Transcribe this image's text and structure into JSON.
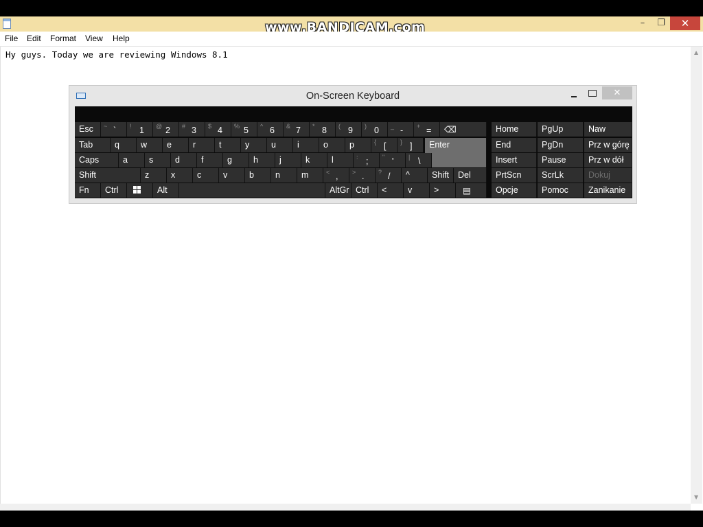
{
  "watermark": "www.BANDICAM.com",
  "window": {
    "minimize_glyph": "–",
    "maximize_glyph": "❐",
    "close_glyph": "✕",
    "icon": "notepad-icon"
  },
  "menu": {
    "items": [
      "File",
      "Edit",
      "Format",
      "View",
      "Help"
    ]
  },
  "editor": {
    "text": "Hy guys. Today we are reviewing Windows 8.1"
  },
  "osk": {
    "title": "On-Screen Keyboard",
    "close_glyph": "✕",
    "rows": {
      "row1": [
        {
          "main": "Esc"
        },
        {
          "shift": "~",
          "main": "`"
        },
        {
          "shift": "!",
          "main": "1"
        },
        {
          "shift": "@",
          "main": "2"
        },
        {
          "shift": "#",
          "main": "3"
        },
        {
          "shift": "$",
          "main": "4"
        },
        {
          "shift": "%",
          "main": "5"
        },
        {
          "shift": "^",
          "main": "6"
        },
        {
          "shift": "&",
          "main": "7"
        },
        {
          "shift": "*",
          "main": "8"
        },
        {
          "shift": "(",
          "main": "9"
        },
        {
          "shift": ")",
          "main": "0"
        },
        {
          "shift": "_",
          "main": "-"
        },
        {
          "shift": "+",
          "main": "="
        },
        {
          "main": "⌫"
        }
      ],
      "row2": [
        {
          "main": "Tab"
        },
        {
          "main": "q"
        },
        {
          "main": "w"
        },
        {
          "main": "e"
        },
        {
          "main": "r"
        },
        {
          "main": "t"
        },
        {
          "main": "y"
        },
        {
          "main": "u"
        },
        {
          "main": "i"
        },
        {
          "main": "o"
        },
        {
          "main": "p"
        },
        {
          "shift": "{",
          "main": "["
        },
        {
          "shift": "}",
          "main": "]"
        },
        {
          "main": "Enter"
        }
      ],
      "row3": [
        {
          "main": "Caps"
        },
        {
          "main": "a"
        },
        {
          "main": "s"
        },
        {
          "main": "d"
        },
        {
          "main": "f"
        },
        {
          "main": "g"
        },
        {
          "main": "h"
        },
        {
          "main": "j"
        },
        {
          "main": "k"
        },
        {
          "main": "l"
        },
        {
          "shift": ":",
          "main": ";"
        },
        {
          "shift": "\"",
          "main": "'"
        },
        {
          "shift": "|",
          "main": "\\"
        }
      ],
      "row4": [
        {
          "main": "Shift"
        },
        {
          "main": "z"
        },
        {
          "main": "x"
        },
        {
          "main": "c"
        },
        {
          "main": "v"
        },
        {
          "main": "b"
        },
        {
          "main": "n"
        },
        {
          "main": "m"
        },
        {
          "shift": "<",
          "main": ","
        },
        {
          "shift": ">",
          "main": "."
        },
        {
          "shift": "?",
          "main": "/"
        },
        {
          "main": "^"
        },
        {
          "main": "Shift"
        },
        {
          "main": "Del"
        }
      ],
      "row5": [
        {
          "main": "Fn"
        },
        {
          "main": "Ctrl"
        },
        {
          "main": "windows-logo"
        },
        {
          "main": "Alt"
        },
        {
          "main": ""
        },
        {
          "main": "AltGr"
        },
        {
          "main": "Ctrl"
        },
        {
          "main": "<"
        },
        {
          "main": "v"
        },
        {
          "main": ">"
        },
        {
          "main": "context-menu-icon"
        }
      ]
    },
    "nav_keys": [
      [
        "Home",
        "PgUp",
        "Naw"
      ],
      [
        "End",
        "PgDn",
        "Prz w górę"
      ],
      [
        "Insert",
        "Pause",
        "Prz w dół"
      ],
      [
        "PrtScn",
        "ScrLk",
        "Dokuj"
      ],
      [
        "Opcje",
        "Pomoc",
        "Zanikanie"
      ]
    ],
    "disabled_key": "Dokuj"
  }
}
